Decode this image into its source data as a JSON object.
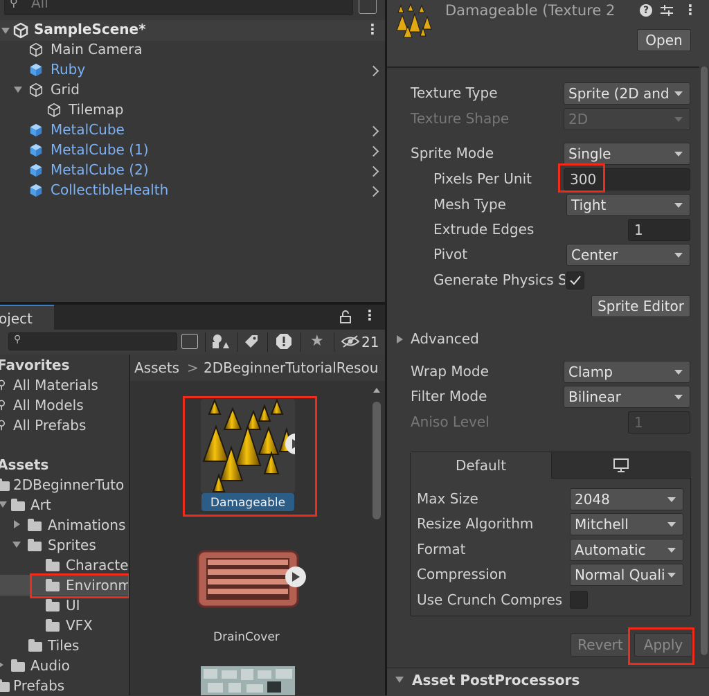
{
  "hierarchy": {
    "search_placeholder": "All",
    "scene_name": "SampleScene*",
    "items": [
      {
        "label": "Main Camera",
        "prefab": false
      },
      {
        "label": "Ruby",
        "prefab": true
      },
      {
        "label": "Grid",
        "prefab": false
      },
      {
        "label": "Tilemap",
        "prefab": false
      },
      {
        "label": "MetalCube",
        "prefab": true
      },
      {
        "label": "MetalCube (1)",
        "prefab": true
      },
      {
        "label": "MetalCube (2)",
        "prefab": true
      },
      {
        "label": "CollectibleHealth",
        "prefab": true
      }
    ]
  },
  "project": {
    "tab_label": "oject",
    "hidden_count": "21",
    "favorites": {
      "header": "Favorites",
      "items": [
        "All Materials",
        "All Models",
        "All Prefabs"
      ]
    },
    "assets": {
      "header": "Assets",
      "tree": [
        "2DBeginnerTuto",
        "Art",
        "Animations",
        "Sprites",
        "Characte",
        "Environm",
        "UI",
        "VFX",
        "Tiles",
        "Audio",
        "Prefabs"
      ]
    },
    "breadcrumb": [
      "Assets",
      "2DBeginnerTutorialResou"
    ],
    "grid_items": [
      {
        "label": "Damageable"
      },
      {
        "label": "DrainCover"
      }
    ]
  },
  "inspector": {
    "title": "Damageable (Texture 2",
    "open_label": "Open",
    "fields": {
      "texture_type": {
        "label": "Texture Type",
        "value": "Sprite (2D and"
      },
      "texture_shape": {
        "label": "Texture Shape",
        "value": "2D"
      },
      "sprite_mode": {
        "label": "Sprite Mode",
        "value": "Single"
      },
      "pixels_per_unit": {
        "label": "Pixels Per Unit",
        "value": "300"
      },
      "mesh_type": {
        "label": "Mesh Type",
        "value": "Tight"
      },
      "extrude_edges": {
        "label": "Extrude Edges",
        "value": "1"
      },
      "pivot": {
        "label": "Pivot",
        "value": "Center"
      },
      "generate_physics": {
        "label": "Generate Physics S"
      },
      "sprite_editor": "Sprite Editor",
      "advanced": "Advanced",
      "wrap_mode": {
        "label": "Wrap Mode",
        "value": "Clamp"
      },
      "filter_mode": {
        "label": "Filter Mode",
        "value": "Bilinear"
      },
      "aniso_level": {
        "label": "Aniso Level",
        "value": "1"
      }
    },
    "platform": {
      "tab_default": "Default",
      "max_size": {
        "label": "Max Size",
        "value": "2048"
      },
      "resize_algorithm": {
        "label": "Resize Algorithm",
        "value": "Mitchell"
      },
      "format": {
        "label": "Format",
        "value": "Automatic"
      },
      "compression": {
        "label": "Compression",
        "value": "Normal Quali"
      },
      "use_crunch": {
        "label": "Use Crunch Compres"
      }
    },
    "revert_label": "Revert",
    "apply_label": "Apply",
    "post_processors": "Asset PostProcessors"
  },
  "colors": {
    "highlight": "#f02b1a",
    "prefab_text": "#7cb2f5",
    "selection": "#2c5d87"
  }
}
